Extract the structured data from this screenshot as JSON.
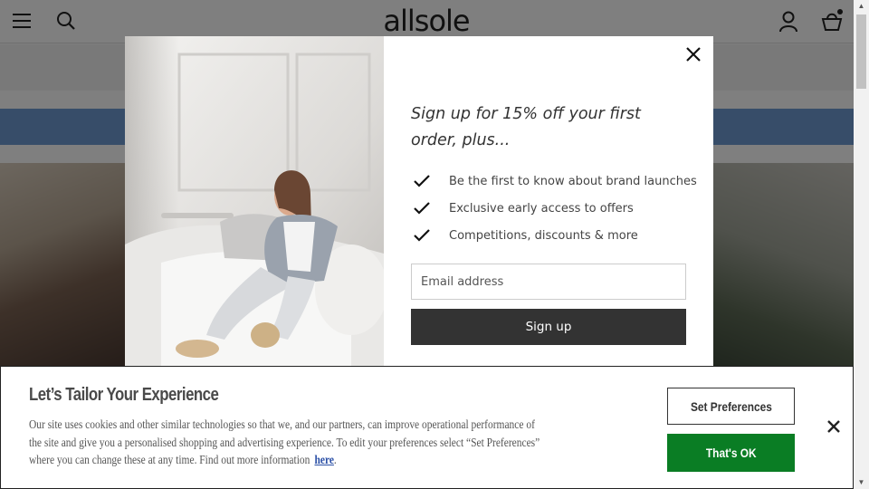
{
  "header": {
    "logo_text": "allsole",
    "icons": [
      "menu-icon",
      "search-icon",
      "account-icon",
      "basket-icon"
    ]
  },
  "modal": {
    "heading": "Sign up for 15% off your first order, plus...",
    "benefits": [
      "Be the first to know about brand launches",
      "Exclusive early access to offers",
      "Competitions, discounts & more"
    ],
    "email_placeholder": "Email address",
    "signup_label": "Sign up",
    "close_icon": "close-icon"
  },
  "cookie_banner": {
    "title": "Let’s Tailor Your Experience",
    "body_line1": "Our site uses cookies and other similar technologies so that we, and our partners, can improve operational performance of",
    "body_line2": "the site and give you a personalised shopping and advertising experience. To edit your preferences select “Set Preferences”",
    "body_line3": "where you can change these at any time. Find out more information",
    "link_text": "here",
    "link_suffix": ".",
    "set_preferences_label": "Set Preferences",
    "ok_label": "That's OK"
  },
  "colors": {
    "promo_band": "#6f9bd3",
    "signup_button": "#333333",
    "ok_button": "#0a7d24",
    "link": "#2a4fa6"
  }
}
